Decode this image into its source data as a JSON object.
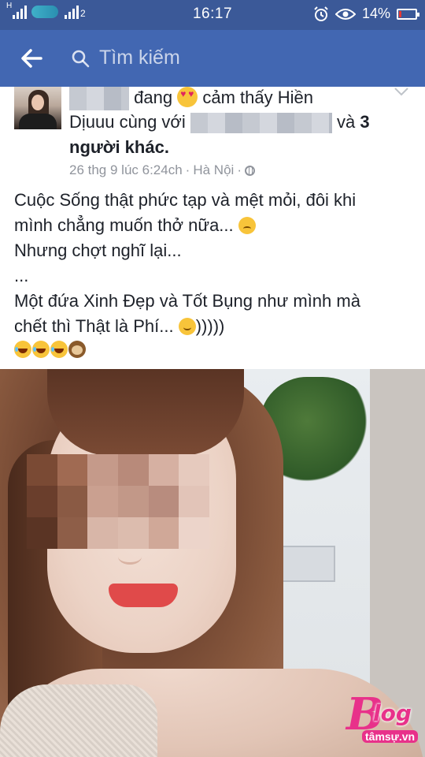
{
  "status_bar": {
    "time": "16:17",
    "battery": "14%",
    "battery_level": 0.14,
    "battery_color": "#e53935",
    "sim1_label": "H",
    "sim2_label": "2",
    "icons": [
      "signal-icon",
      "carrier-logo-icon",
      "signal-icon",
      "alarm-icon",
      "eye-icon",
      "battery-icon"
    ]
  },
  "app_bar": {
    "back_icon": "arrow-left-icon",
    "search_icon": "search-icon",
    "search_placeholder": "Tìm kiếm",
    "colors": {
      "bar": "#4267b2",
      "status": "#3b5998"
    }
  },
  "post": {
    "status_prefix": "đang",
    "feeling_emoji": "heart-eyes-emoji",
    "feeling": "cảm thấy Hiền",
    "feeling_cont": "Dịuuu cùng với",
    "and_text": "và",
    "others": "3",
    "others_line2": "người khác.",
    "timestamp": "26 thg 9 lúc 6:24ch",
    "location": "Hà Nội",
    "separator": "·",
    "privacy_icon": "globe-icon",
    "lines": [
      "Cuộc Sống thật phức tạp và mệt mỏi, đôi khi",
      "mình chẳng muốn thở nữa...",
      "Nhưng chợt nghĩ lại...",
      "...",
      "Một đứa Xinh Đẹp và Tốt Bụng như mình mà",
      "chết thì Thật là Phí...",
      ")))))"
    ],
    "emoji_row": [
      "laughing-emoji",
      "laughing-emoji",
      "laughing-emoji",
      "see-no-evil-monkey-emoji"
    ]
  },
  "watermark": {
    "main": "log",
    "sub": "tâmsự.vn"
  }
}
